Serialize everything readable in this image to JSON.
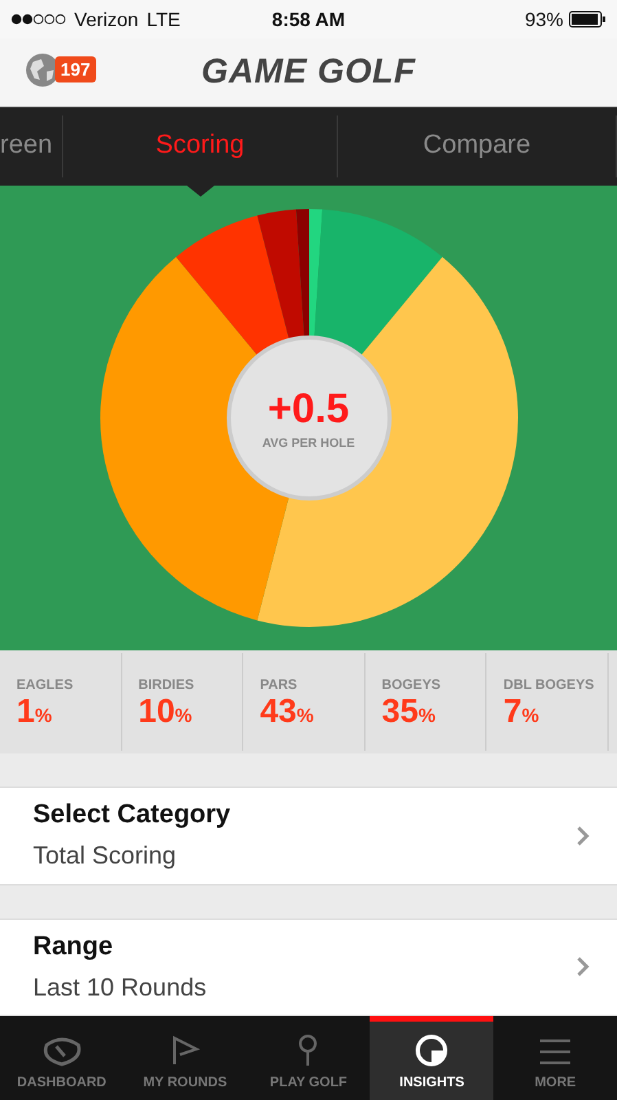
{
  "status_bar": {
    "carrier": "Verizon",
    "network": "LTE",
    "time": "8:58 AM",
    "battery": "93%"
  },
  "header": {
    "badge": "197",
    "title": "GAME GOLF"
  },
  "tabs": [
    {
      "label": "reen",
      "selected": false
    },
    {
      "label": "Scoring",
      "selected": true
    },
    {
      "label": "Compare",
      "selected": false
    }
  ],
  "summary": {
    "value": "+0.5",
    "label": "AVG PER HOLE"
  },
  "stats": [
    {
      "label": "EAGLES",
      "value": "1",
      "unit": "%"
    },
    {
      "label": "BIRDIES",
      "value": "10",
      "unit": "%"
    },
    {
      "label": "PARS",
      "value": "43",
      "unit": "%"
    },
    {
      "label": "BOGEYS",
      "value": "35",
      "unit": "%"
    },
    {
      "label": "DBL BOGEYS",
      "value": "7",
      "unit": "%"
    }
  ],
  "settings": [
    {
      "title": "Select Category",
      "value": "Total Scoring"
    },
    {
      "title": "Range",
      "value": "Last 10 Rounds"
    }
  ],
  "nav": [
    {
      "label": "DASHBOARD",
      "selected": false
    },
    {
      "label": "MY ROUNDS",
      "selected": false
    },
    {
      "label": "PLAY GOLF",
      "selected": false
    },
    {
      "label": "INSIGHTS",
      "selected": true
    },
    {
      "label": "MORE",
      "selected": false
    }
  ]
}
